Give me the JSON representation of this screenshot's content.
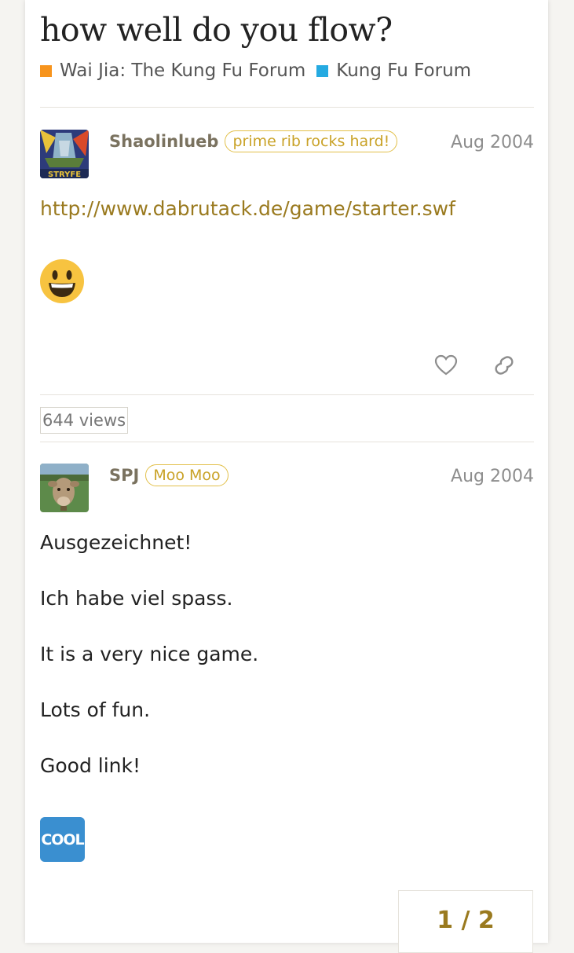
{
  "topic": {
    "title": "how well do you flow?",
    "categories": [
      {
        "label": "Wai Jia: The Kung Fu Forum",
        "color": "#f7941d"
      },
      {
        "label": "Kung Fu Forum",
        "color": "#25aae1"
      }
    ],
    "views": "644 views"
  },
  "posts": [
    {
      "username": "Shaolinlueb",
      "flair": "prime rib rocks hard!",
      "date": "Aug 2004",
      "link": "http://www.dabrutack.de/game/starter.swf",
      "emoji": "grinning-face-emoji"
    },
    {
      "username": "SPJ",
      "flair": "Moo Moo",
      "date": "Aug 2004",
      "paragraphs": [
        "Ausgezeichnet!",
        "Ich habe viel spass.",
        "It is a very nice game.",
        "Lots of fun.",
        "Good link!"
      ],
      "badge": "COOL"
    }
  ],
  "pager": {
    "label": "1 / 2"
  },
  "colors": {
    "accent": "#9a7a1f",
    "flair_border": "#e2c04a"
  }
}
